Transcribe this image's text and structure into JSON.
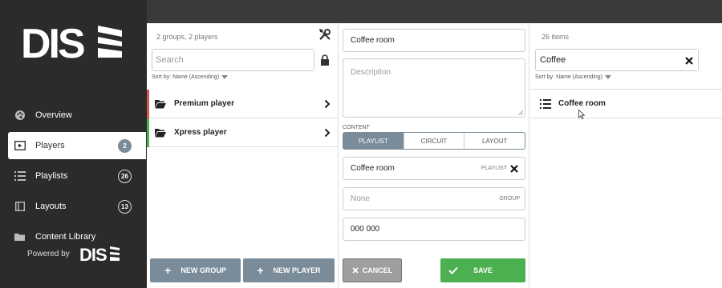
{
  "sidebar": {
    "logo_text": "DISE",
    "items": [
      {
        "label": "Overview",
        "icon": "palette-icon"
      },
      {
        "label": "Players",
        "icon": "player-icon",
        "count": "2",
        "active": true
      },
      {
        "label": "Playlists",
        "icon": "list-icon",
        "count": "26"
      },
      {
        "label": "Layouts",
        "icon": "layout-icon",
        "count": "13"
      },
      {
        "label": "Content Library",
        "icon": "folder-icon"
      }
    ],
    "powered_by": "Powered by"
  },
  "groups_panel": {
    "summary": "2 groups, 2 players",
    "search_placeholder": "Search",
    "sort_label": "Sort by: Name (Ascending)",
    "rows": [
      {
        "label": "Premium player",
        "bar_color": "#d9534f"
      },
      {
        "label": "Xpress player",
        "bar_color": "#4caf50"
      }
    ],
    "new_group": "NEW GROUP",
    "new_player": "NEW PLAYER"
  },
  "editor": {
    "name_value": "Coffee room",
    "description_placeholder": "Description",
    "content_label": "CONTENT",
    "tabs": [
      "PLAYLIST",
      "CIRCUIT",
      "LAYOUT"
    ],
    "content_value": "Coffee room",
    "content_tag": "PLAYLIST",
    "group_placeholder": "None",
    "group_tag": "GROUP",
    "code_value": "000 000",
    "cancel": "CANCEL",
    "save": "SAVE"
  },
  "items_panel": {
    "count": "26 items",
    "search_value": "Coffee",
    "sort_label": "Sort by: Name (Ascending)",
    "items": [
      {
        "label": "Coffee room"
      }
    ]
  },
  "colors": {
    "sidebar_bg": "#2b2b2b",
    "accent_gray_blue": "#7a8c9a",
    "save_green": "#4caf50",
    "cancel_gray": "#9e9e9e"
  }
}
